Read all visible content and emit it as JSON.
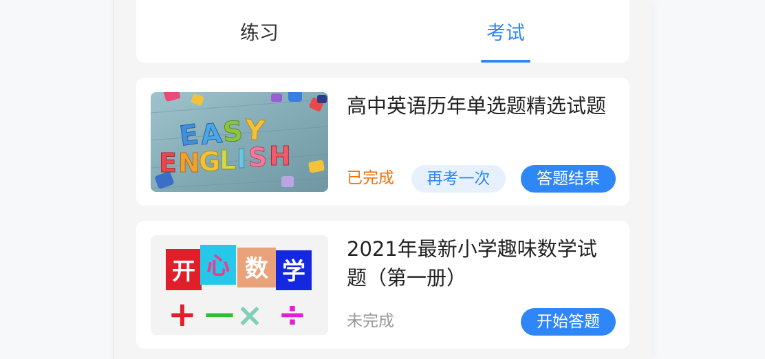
{
  "tabs": [
    {
      "label": "练习",
      "active": false
    },
    {
      "label": "考试",
      "active": true
    }
  ],
  "exams": [
    {
      "title": "高中英语历年单选题精选试题",
      "thumbnail": {
        "letters_top": "EASY",
        "letters_bottom": "ENGLISH"
      },
      "status": "已完成",
      "status_color": "#f0720e",
      "actions": [
        "再考一次",
        "答题结果"
      ]
    },
    {
      "title": "2021年最新小学趣味数学试题（第一册）",
      "thumbnail": {
        "tiles": [
          "开",
          "心",
          "数",
          "学"
        ],
        "symbols": [
          "+",
          "—",
          "×",
          "÷"
        ]
      },
      "status": "未完成",
      "status_color": "#999999",
      "actions": [
        "开始答题"
      ]
    }
  ],
  "colors": {
    "accent": "#2f86f6",
    "accent_light": "#e6f1fd"
  }
}
